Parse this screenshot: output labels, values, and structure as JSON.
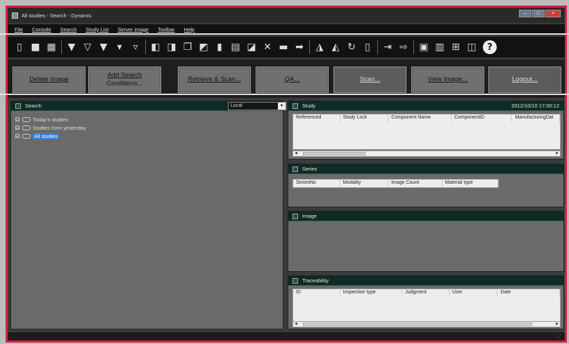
{
  "window": {
    "title": "All studies - Search - Dynamis",
    "minimize": "–",
    "maximize": "□",
    "close": "×"
  },
  "menu": [
    "File",
    "Console",
    "Search",
    "Study List",
    "Server image",
    "Toolbar",
    "Help"
  ],
  "toolbar": {
    "help_glyph": "?"
  },
  "buttons": {
    "delete_image": "Delete Image",
    "add_search_line1": "Add Search",
    "add_search_line2": "Conditions...",
    "retrieve_scan": "Retrieve & Scan...",
    "qa": "QA...",
    "scan": "Scan...",
    "view_image": "View Image...",
    "logout": "Logout..."
  },
  "search": {
    "title": "Search",
    "location": "Local",
    "tree": [
      "Today's studies",
      "Studies from yesterday",
      "All studies"
    ]
  },
  "study": {
    "title": "Study",
    "datetime": "2012/10/10 17:00:12",
    "columns": [
      "Referenced",
      "Study Lock",
      "Component Name",
      "ComponentID",
      "ManufacturingDat"
    ]
  },
  "series": {
    "title": "Series",
    "columns": [
      "SeriesNo",
      "Modality",
      "Image Count",
      "Material type"
    ]
  },
  "image": {
    "title": "Image"
  },
  "traceability": {
    "title": "Traceability",
    "columns": [
      "ID",
      "Inspection type",
      "Judgment",
      "User",
      "Date"
    ]
  },
  "colors": {
    "frame_border": "#e0203c",
    "panel_header": "#0e2b25",
    "selection": "#3a7bd5"
  }
}
